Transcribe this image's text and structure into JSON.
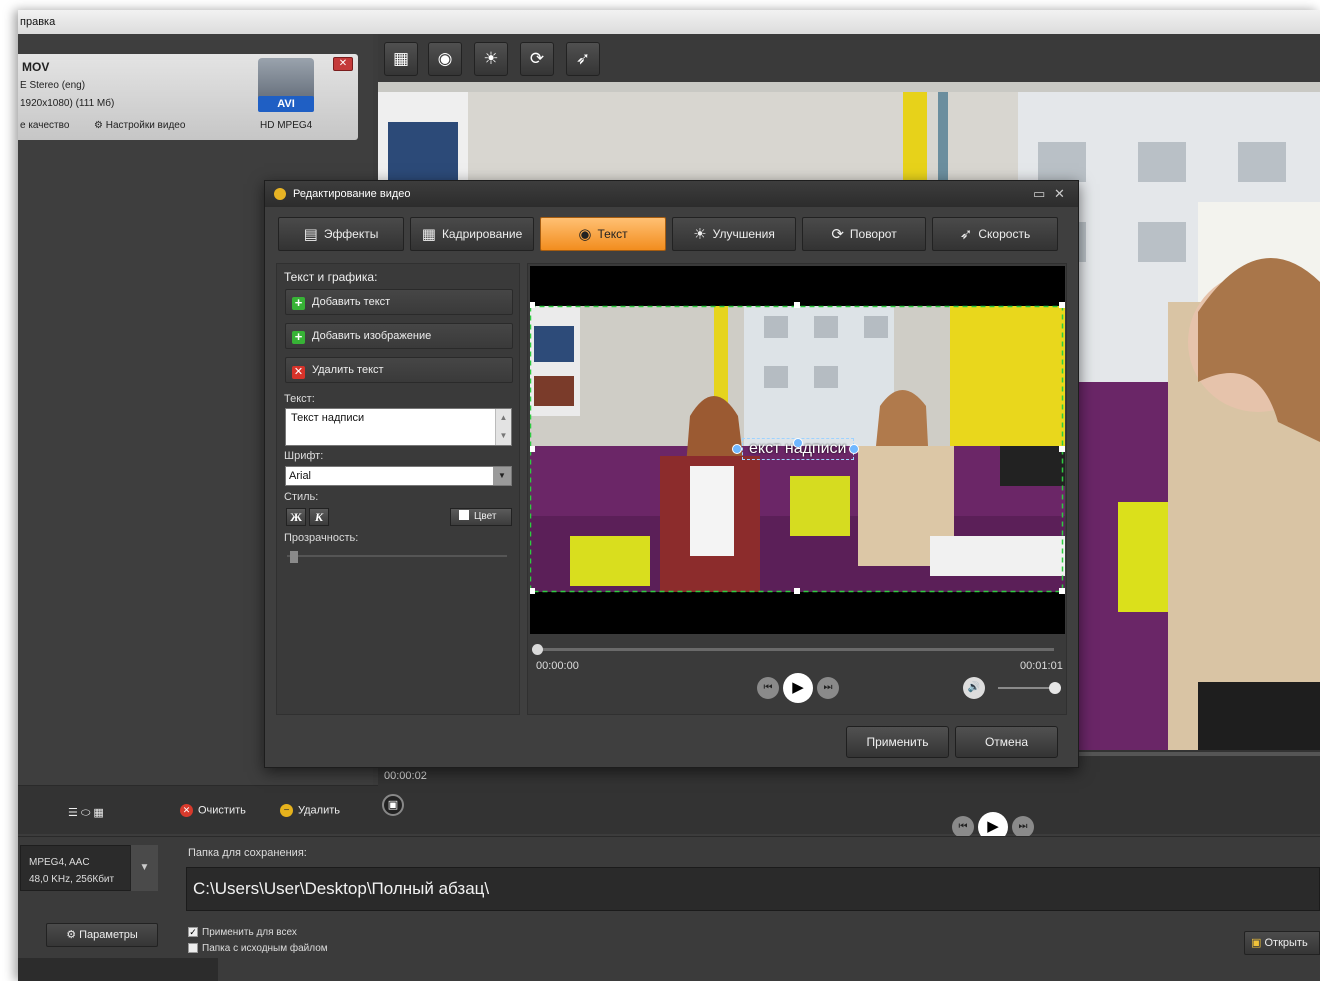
{
  "menubar": {
    "label": "правка"
  },
  "file_card": {
    "name": "MOV",
    "audio": "E Stereo (eng)",
    "resolution": "1920x1080) (111 Мб)",
    "quality": "е качество",
    "video_settings": "Настройки видео",
    "badge": "AVI",
    "format": "HD MPEG4",
    "close_glyph": "✕"
  },
  "toolbar": {
    "icons": [
      "crop-icon",
      "text-icon",
      "brightness-icon",
      "rotate-icon",
      "speed-icon"
    ]
  },
  "main_timeline": {
    "time": "00:00:02"
  },
  "left_bottom": {
    "clear_label": "Очистить",
    "delete_label": "Удалить"
  },
  "bottom": {
    "format_line1": "MPEG4, AAC",
    "format_line2": "48,0 KHz, 256Кбит",
    "params_label": "Параметры",
    "save_folder_label": "Папка для сохранения:",
    "save_path": "C:\\Users\\User\\Desktop\\Полный абзац\\",
    "apply_all_label": "Применить для всех",
    "source_folder_label": "Папка с исходным файлом",
    "open_label": "Открыть"
  },
  "dialog": {
    "title": "Редактирование видео",
    "tabs": [
      {
        "label": "Эффекты",
        "icon": "effects-icon"
      },
      {
        "label": "Кадрирование",
        "icon": "crop-icon"
      },
      {
        "label": "Текст",
        "icon": "text-icon"
      },
      {
        "label": "Улучшения",
        "icon": "brightness-icon"
      },
      {
        "label": "Поворот",
        "icon": "rotate-icon"
      },
      {
        "label": "Скорость",
        "icon": "speed-icon"
      }
    ],
    "active_tab": "Текст",
    "panel_heading": "Текст и графика:",
    "add_text": "Добавить текст",
    "add_image": "Добавить изображение",
    "delete_text": "Удалить текст",
    "text_label": "Текст:",
    "text_value": "Текст надписи",
    "font_label": "Шрифт:",
    "font_value": "Arial",
    "style_label": "Стиль:",
    "bold_glyph": "Ж",
    "italic_glyph": "К",
    "color_label": "Цвет",
    "opacity_label": "Прозрачность:",
    "overlay_text": "екст надписи",
    "time_start": "00:00:00",
    "time_end": "00:01:01",
    "apply_label": "Применить",
    "cancel_label": "Отмена"
  }
}
